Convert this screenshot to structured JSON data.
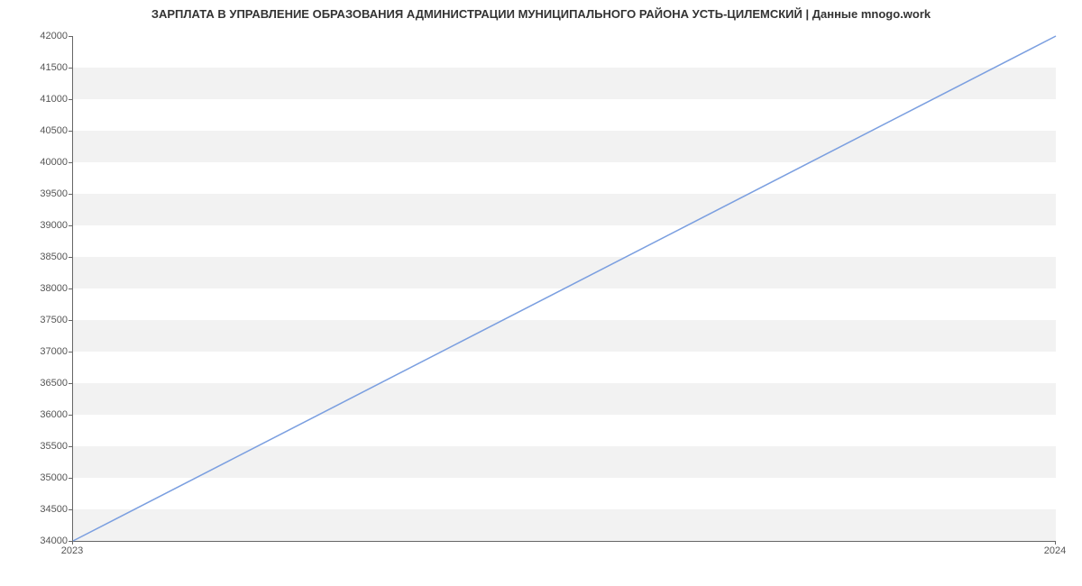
{
  "chart_data": {
    "type": "line",
    "title": "ЗАРПЛАТА В УПРАВЛЕНИЕ ОБРАЗОВАНИЯ АДМИНИСТРАЦИИ МУНИЦИПАЛЬНОГО РАЙОНА УСТЬ-ЦИЛЕМСКИЙ | Данные mnogo.work",
    "x": [
      2023,
      2024
    ],
    "values": [
      34000,
      42000
    ],
    "xlabel": "",
    "ylabel": "",
    "xlim": [
      2023,
      2024
    ],
    "ylim": [
      34000,
      42000
    ],
    "y_ticks": [
      34000,
      34500,
      35000,
      35500,
      36000,
      36500,
      37000,
      37500,
      38000,
      38500,
      39000,
      39500,
      40000,
      40500,
      41000,
      41500,
      42000
    ],
    "x_ticks": [
      2023,
      2024
    ],
    "line_color": "#7b9fe0"
  }
}
